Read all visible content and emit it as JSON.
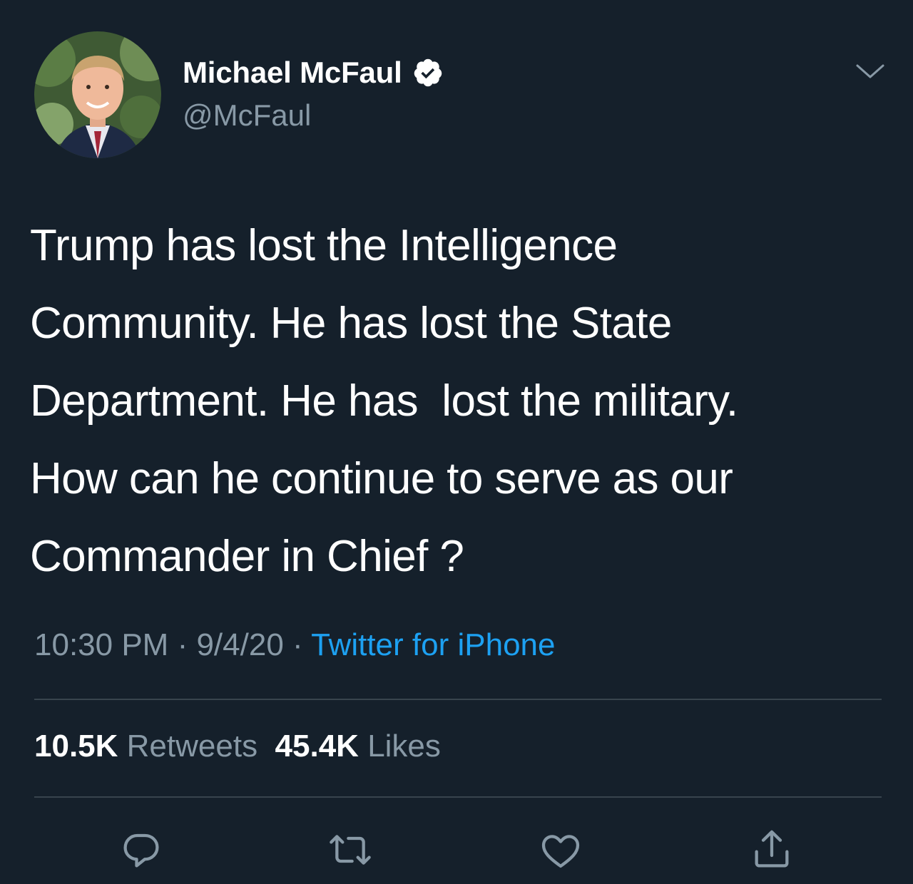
{
  "user": {
    "display_name": "Michael McFaul",
    "handle": "@McFaul",
    "verified": true,
    "avatar_icon": "profile-photo"
  },
  "tweet": {
    "text": "Trump has lost the Intelligence\nCommunity. He has lost the State\nDepartment. He has  lost the military.\nHow can he continue to serve as our\nCommander in Chief ?",
    "time": "10:30 PM",
    "separator": " · ",
    "date": "9/4/20",
    "source": "Twitter for iPhone"
  },
  "stats": {
    "retweets_count": "10.5K",
    "retweets_label": "Retweets",
    "likes_count": "45.4K",
    "likes_label": "Likes"
  },
  "actions": {
    "reply_icon": "reply-icon",
    "retweet_icon": "retweet-icon",
    "like_icon": "heart-icon",
    "share_icon": "share-icon"
  },
  "colors": {
    "background": "#15202b",
    "secondary_text": "#8899a6",
    "accent": "#1da1f2",
    "divider": "#38444d"
  }
}
